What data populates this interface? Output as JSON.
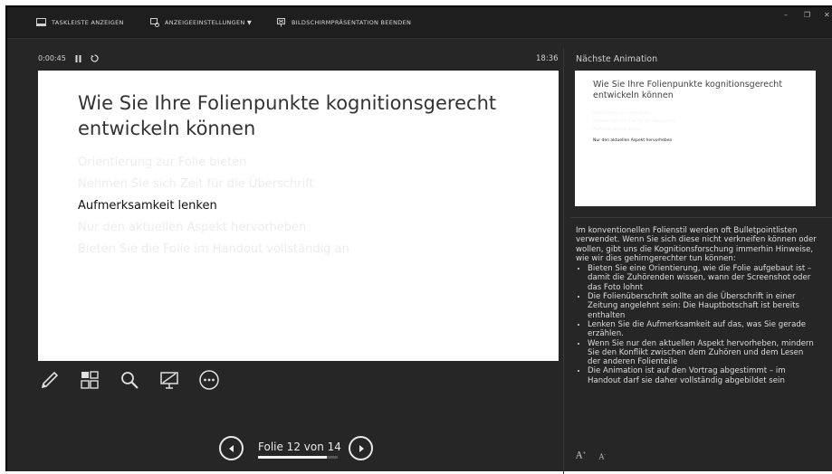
{
  "topbar": {
    "show_taskbar": "TASKLEISTE ANZEIGEN",
    "display_settings": "ANZEIGEEINSTELLUNGEN ▼",
    "end_show": "BILDSCHIRMPRÄSENTATION BEENDEN",
    "minimize": "–",
    "restore": "❐",
    "close": "✕"
  },
  "timer": {
    "elapsed": "0:00:45",
    "clock": "18:36"
  },
  "slide": {
    "title": "Wie Sie Ihre Folienpunkte kognitionsgerecht entwickeln können",
    "bullets": [
      "Orientierung zur Folie bieten",
      "Nehmen Sie sich Zeit für die Überschrift",
      "Aufmerksamkeit lenken",
      "Nur den aktuellen Aspekt hervorheben",
      "Bieten Sie die Folie im Handout vollständig an"
    ],
    "active_index": 2
  },
  "tools": [
    "pen-icon",
    "slides-grid-icon",
    "zoom-icon",
    "screen-icon",
    "more-icon"
  ],
  "navigation": {
    "label": "Folie 12 von 14",
    "progress": 0.86
  },
  "next_panel": {
    "title": "Nächste Animation",
    "thumb_title": "Wie Sie Ihre Folienpunkte kognitionsgerecht entwickeln können",
    "thumb_bullets": [
      "Orientierung zur Folie bieten",
      "Nehmen Sie sich Zeit für die Überschrift",
      "Aufmerksamkeit lenken",
      "Nur den aktuellen Aspekt hervorheben"
    ]
  },
  "notes": {
    "intro": "Im konventionellen Folienstil werden oft Bulletpointlisten verwendet. Wenn Sie sich diese nicht verkneifen können oder wollen, gibt uns die Kognitionsforschung immerhin Hinweise, wie wir dies gehirngerechter tun können:",
    "items": [
      "Bieten Sie eine Orientierung, wie die Folie aufgebaut ist – damit die Zuhörenden wissen, wann der Screenshot oder das Foto lohnt",
      "Die Folienüberschrift sollte an die Überschrift in einer Zeitung angelehnt sein: Die Hauptbotschaft ist bereits enthalten",
      "Lenken Sie die Aufmerksamkeit auf das, was Sie gerade erzählen.",
      "Wenn Sie nur den aktuellen Aspekt hervorheben, mindern Sie den Konflikt zwischen dem Zuhören und dem Lesen der anderen Folienteile",
      "Die Animation ist auf den Vortrag abgestimmt – im Handout darf sie daher vollständig abgebildet sein"
    ]
  },
  "font_controls": {
    "increase": "A",
    "decrease": "A"
  }
}
